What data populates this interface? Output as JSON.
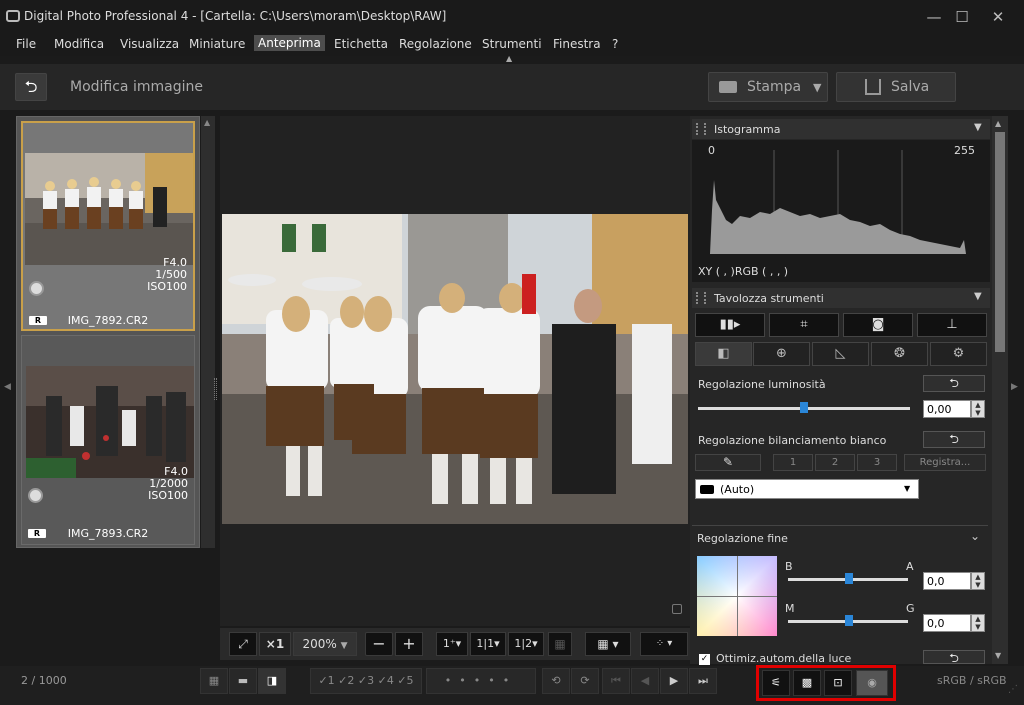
{
  "window": {
    "title": "Digital Photo Professional 4 - [Cartella: C:\\Users\\moram\\Desktop\\RAW]",
    "minimize": "—",
    "maximize": "☐",
    "close": "✕"
  },
  "menu": [
    "File",
    "Modifica",
    "Visualizza",
    "Miniature",
    "Anteprima",
    "Etichetta",
    "Regolazione",
    "Strumenti",
    "Finestra",
    "?"
  ],
  "toolbar": {
    "back": "⮌",
    "title": "Modifica immagine",
    "print_label": "Stampa",
    "print_arrow": "▼",
    "save_label": "Salva"
  },
  "thumbnails": [
    {
      "aperture": "F4.0",
      "shutter": "1/500",
      "iso": "ISO100",
      "name": "IMG_7892.CR2",
      "badge": "R"
    },
    {
      "aperture": "F4.0",
      "shutter": "1/2000",
      "iso": "ISO100",
      "name": "IMG_7893.CR2",
      "badge": "R"
    }
  ],
  "viewbar": {
    "zoom_x1": "×1",
    "zoom": "200%",
    "zoom_arrow": "▼",
    "minus": "−",
    "plus": "+"
  },
  "histogram": {
    "title": "Istogramma",
    "min": "0",
    "max": "255",
    "readout": "XY (     ,     )RGB (     ,     ,     )"
  },
  "tools": {
    "title": "Tavolozza strumenti",
    "brightness_label": "Regolazione luminosità",
    "brightness_value": "0,00",
    "brightness_level": 0.5,
    "wb_label": "Regolazione bilanciamento bianco",
    "wb_buttons": [
      "1",
      "2",
      "3"
    ],
    "wb_register": "Registra...",
    "wb_mode": "(Auto)",
    "fine_label": "Regolazione fine",
    "axis_b": "B",
    "axis_a": "A",
    "axis_m": "M",
    "axis_g": "G",
    "ba_value": "0,0",
    "mg_value": "0,0",
    "auto_light": "Ottimiz.autom.della luce",
    "reset": "⮌"
  },
  "status": {
    "count": "2 / 1000",
    "colorspace": "sRGB / sRGB",
    "ratings": [
      "✓1",
      "✓2",
      "✓3",
      "✓4",
      "✓5"
    ]
  },
  "colors": {
    "accent": "#c9a04a",
    "slider": "#2a86d8",
    "highlight_box": "#e00000"
  }
}
